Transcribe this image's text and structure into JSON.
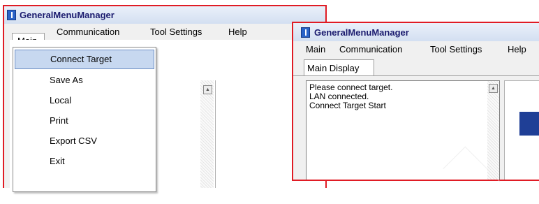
{
  "window_left": {
    "title": "GeneralMenuManager",
    "menu": [
      "Main",
      "Communication",
      "Tool Settings",
      "Help"
    ],
    "dropdown_items": [
      "Connect Target",
      "Save As",
      "Local",
      "Print",
      "Export CSV",
      "Exit"
    ],
    "highlighted_item": "Connect Target"
  },
  "window_right": {
    "title": "GeneralMenuManager",
    "menu": [
      "Main",
      "Communication",
      "Tool Settings",
      "Help"
    ],
    "tab": "Main Display",
    "log_lines": [
      "Please connect target.",
      "LAN connected.",
      "Connect Target Start"
    ]
  },
  "colors": {
    "frame_highlight": "#e01b24",
    "menu_highlight": "#c7d8f0",
    "title_text": "#1a1a6e"
  },
  "icons": [
    "app-icon",
    "scroll-up-arrow-icon"
  ]
}
